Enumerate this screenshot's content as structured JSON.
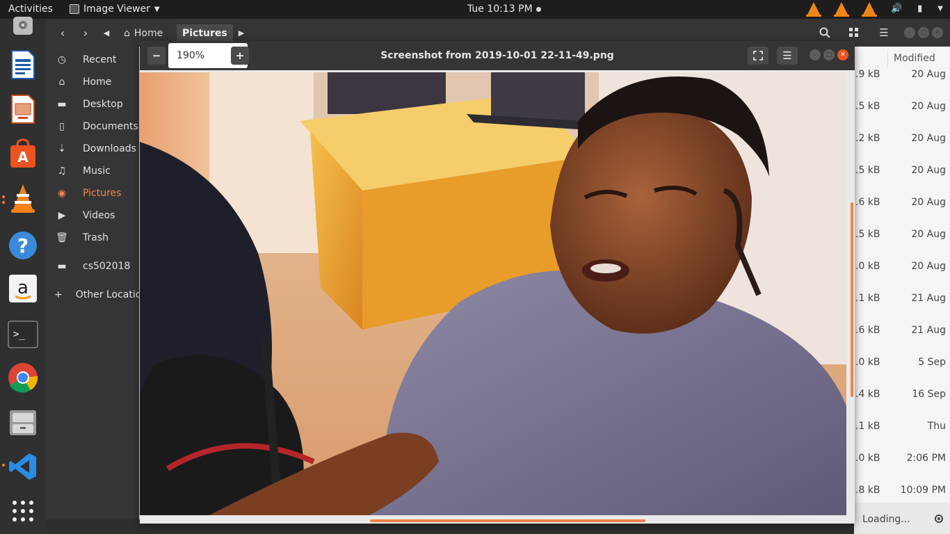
{
  "topbar": {
    "activities": "Activities",
    "app_name": "Image Viewer",
    "clock": "Tue 10:13 PM"
  },
  "dock": {
    "items": [
      "disk-icon",
      "writer-icon",
      "impress-icon",
      "software-center-icon",
      "vlc-icon",
      "help-icon",
      "amazon-icon",
      "terminal-icon",
      "chrome-icon",
      "files-cabinet-icon",
      "vscode-icon",
      "app-grid-icon"
    ]
  },
  "files": {
    "breadcrumb": {
      "home": "Home",
      "current": "Pictures"
    },
    "sidebar": [
      {
        "label": "Recent",
        "icon": "clock-icon"
      },
      {
        "label": "Home",
        "icon": "home-icon"
      },
      {
        "label": "Desktop",
        "icon": "folder-icon"
      },
      {
        "label": "Documents",
        "icon": "document-icon"
      },
      {
        "label": "Downloads",
        "icon": "download-icon"
      },
      {
        "label": "Music",
        "icon": "music-icon"
      },
      {
        "label": "Pictures",
        "icon": "camera-icon"
      },
      {
        "label": "Videos",
        "icon": "video-icon"
      },
      {
        "label": "Trash",
        "icon": "trash-icon"
      },
      {
        "label": "cs502018",
        "icon": "folder-icon"
      },
      {
        "label": "Other Locations",
        "icon": "plus-icon"
      }
    ],
    "column_header": "Modified",
    "rows": [
      {
        "size": ".9 kB",
        "modified": "20 Aug"
      },
      {
        "size": ".5 kB",
        "modified": "20 Aug"
      },
      {
        "size": ".2 kB",
        "modified": "20 Aug"
      },
      {
        "size": ".5 kB",
        "modified": "20 Aug"
      },
      {
        "size": ".6 kB",
        "modified": "20 Aug"
      },
      {
        "size": ".5 kB",
        "modified": "20 Aug"
      },
      {
        "size": ".0 kB",
        "modified": "20 Aug"
      },
      {
        "size": ".1 kB",
        "modified": "21 Aug"
      },
      {
        "size": ".6 kB",
        "modified": "21 Aug"
      },
      {
        "size": ".0 kB",
        "modified": "5 Sep"
      },
      {
        "size": ".4 kB",
        "modified": "16 Sep"
      },
      {
        "size": ".1 kB",
        "modified": "Thu"
      },
      {
        "size": ".0 kB",
        "modified": "2:06 PM"
      },
      {
        "size": ".8 kB",
        "modified": "10:09 PM"
      }
    ],
    "loading": "Loading..."
  },
  "viewer": {
    "zoom": "190%",
    "title": "Screenshot from 2019-10-01 22-11-49.png"
  }
}
